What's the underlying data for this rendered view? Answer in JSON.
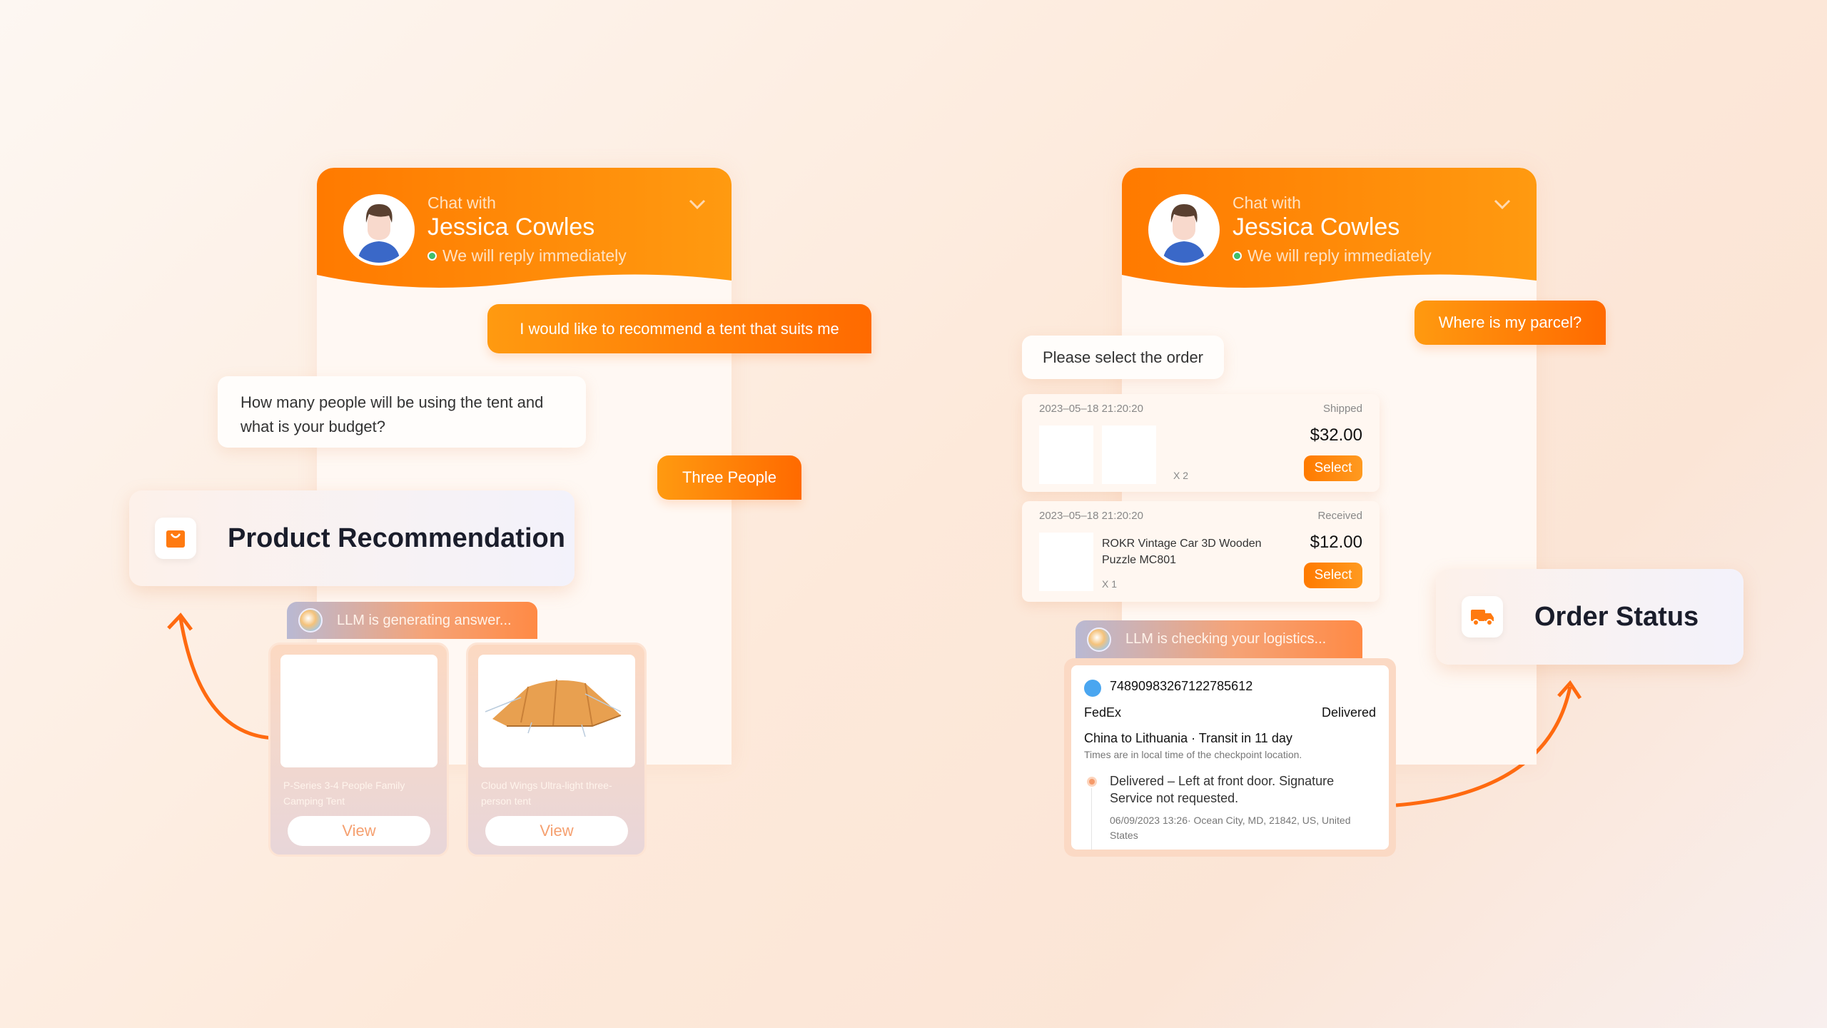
{
  "left_chat": {
    "header": {
      "chat_with": "Chat with",
      "agent_name": "Jessica Cowles",
      "status": "We will reply immediately"
    },
    "messages": [
      {
        "from": "user",
        "text": "I would like to recommend a tent that suits me"
      },
      {
        "from": "agent",
        "text": "How many people will be using the tent and what is your budget?"
      },
      {
        "from": "user",
        "text": "Three People"
      }
    ],
    "feature_label": "Product Recommendation",
    "llm_status": "LLM is generating answer...",
    "products": [
      {
        "name": "P-Series 3-4 People Family Camping Tent",
        "button": "View"
      },
      {
        "name": "Cloud Wings Ultra-light three-person tent",
        "button": "View"
      }
    ]
  },
  "right_chat": {
    "header": {
      "chat_with": "Chat with",
      "agent_name": "Jessica Cowles",
      "status": "We will reply immediately"
    },
    "user_message": "Where is my parcel?",
    "agent_message": "Please select the order",
    "orders": [
      {
        "time": "2023–05–18 21:20:20",
        "status": "Shipped",
        "price": "$32.00",
        "qty": "X 2",
        "button": "Select"
      },
      {
        "time": "2023–05–18 21:20:20",
        "status": "Received",
        "product": "ROKR Vintage Car 3D Wooden Puzzle MC801",
        "price": "$12.00",
        "qty": "X 1",
        "button": "Select"
      }
    ],
    "llm_status": "LLM is checking your logistics...",
    "logistics": {
      "tracking_number": "74890983267122785612",
      "carrier": "FedEx",
      "status": "Delivered",
      "route": "China to Lithuania · Transit in 11 day",
      "note": "Times are in local time of the checkpoint location.",
      "event": "Delivered – Left at front door. Signature Service not requested.",
      "event_detail": "06/09/2023 13:26· Ocean City, MD, 21842, US, United States"
    },
    "feature_label": "Order Status"
  },
  "colors": {
    "accent": "#ff7a00",
    "online": "#3fbf6a"
  }
}
